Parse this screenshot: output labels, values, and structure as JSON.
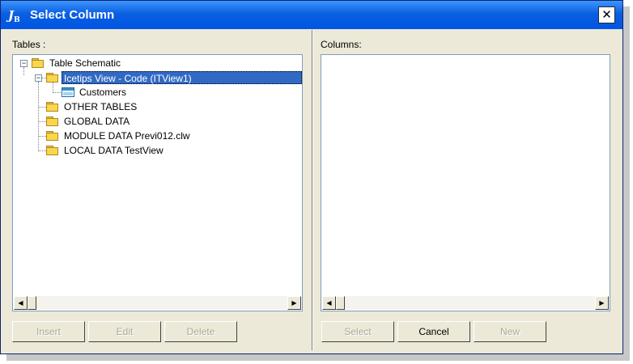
{
  "window": {
    "title": "Select Column",
    "close_glyph": "✕"
  },
  "tables_panel": {
    "label": "Tables :",
    "tree": [
      {
        "label": "Table Schematic",
        "icon": "folder-icon"
      },
      {
        "label": "Icetips View - Code (ITView1)",
        "icon": "folder-icon",
        "selected": true
      },
      {
        "label": "Customers",
        "icon": "table-icon"
      },
      {
        "label": "OTHER TABLES",
        "icon": "folder-icon"
      },
      {
        "label": "GLOBAL DATA",
        "icon": "folder-icon"
      },
      {
        "label": "MODULE DATA Previ012.clw",
        "icon": "folder-icon"
      },
      {
        "label": "LOCAL DATA TestView",
        "icon": "folder-icon"
      }
    ],
    "buttons": {
      "insert": "Insert",
      "edit": "Edit",
      "delete": "Delete"
    }
  },
  "columns_panel": {
    "label": "Columns:",
    "buttons": {
      "select": "Select",
      "cancel": "Cancel",
      "new": "New"
    }
  },
  "colors": {
    "titlebar": "#0055e5",
    "selection": "#316ac5",
    "face": "#ece9d8"
  }
}
